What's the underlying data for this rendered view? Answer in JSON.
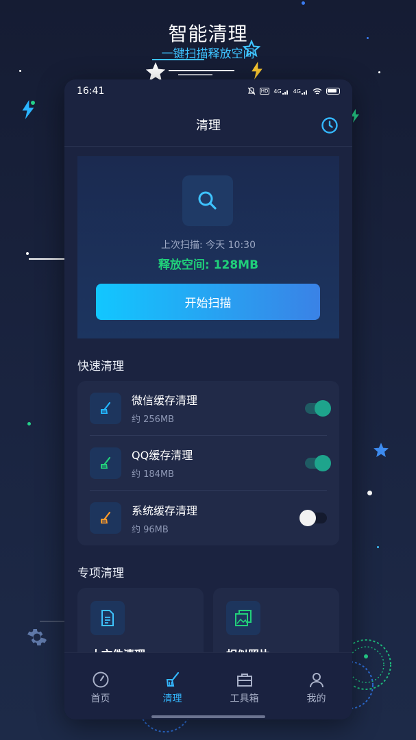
{
  "promo": {
    "title": "智能清理",
    "subtitle": "一键扫描释放空间"
  },
  "status_bar": {
    "time": "16:41",
    "icons": [
      "mute-icon",
      "hd-icon",
      "4g-signal-icon",
      "4g-signal-icon",
      "wifi-icon",
      "battery-icon"
    ],
    "hd_label": "HD",
    "network_label": "4G"
  },
  "header": {
    "title": "清理",
    "history_icon": "clock-icon"
  },
  "scan_card": {
    "icon": "search-icon",
    "last_scan": "上次扫描: 今天 10:30",
    "freed_space": "释放空间: 128MB",
    "button_label": "开始扫描"
  },
  "quick_clean": {
    "title": "快速清理",
    "items": [
      {
        "title": "微信缓存清理",
        "size": "约 256MB",
        "enabled": true,
        "icon": "broom-icon",
        "icon_color": "#23b6ff"
      },
      {
        "title": "QQ缓存清理",
        "size": "约 184MB",
        "enabled": true,
        "icon": "broom-icon",
        "icon_color": "#22d07a"
      },
      {
        "title": "系统缓存清理",
        "size": "约 96MB",
        "enabled": false,
        "icon": "broom-icon",
        "icon_color": "#ff9b2a"
      }
    ]
  },
  "special_clean": {
    "title": "专项清理",
    "items": [
      {
        "title": "大文件清理",
        "icon": "document-icon"
      },
      {
        "title": "相似照片",
        "icon": "photos-icon"
      }
    ]
  },
  "bottom_nav": {
    "items": [
      {
        "label": "首页",
        "icon": "gauge-icon",
        "active": false
      },
      {
        "label": "清理",
        "icon": "broom-icon",
        "active": true
      },
      {
        "label": "工具箱",
        "icon": "toolbox-icon",
        "active": false
      },
      {
        "label": "我的",
        "icon": "user-icon",
        "active": false
      }
    ]
  },
  "colors": {
    "accent": "#34b8ff",
    "success": "#20d07a",
    "toggle_on": "#1ea48c",
    "background": "#1b2340"
  }
}
